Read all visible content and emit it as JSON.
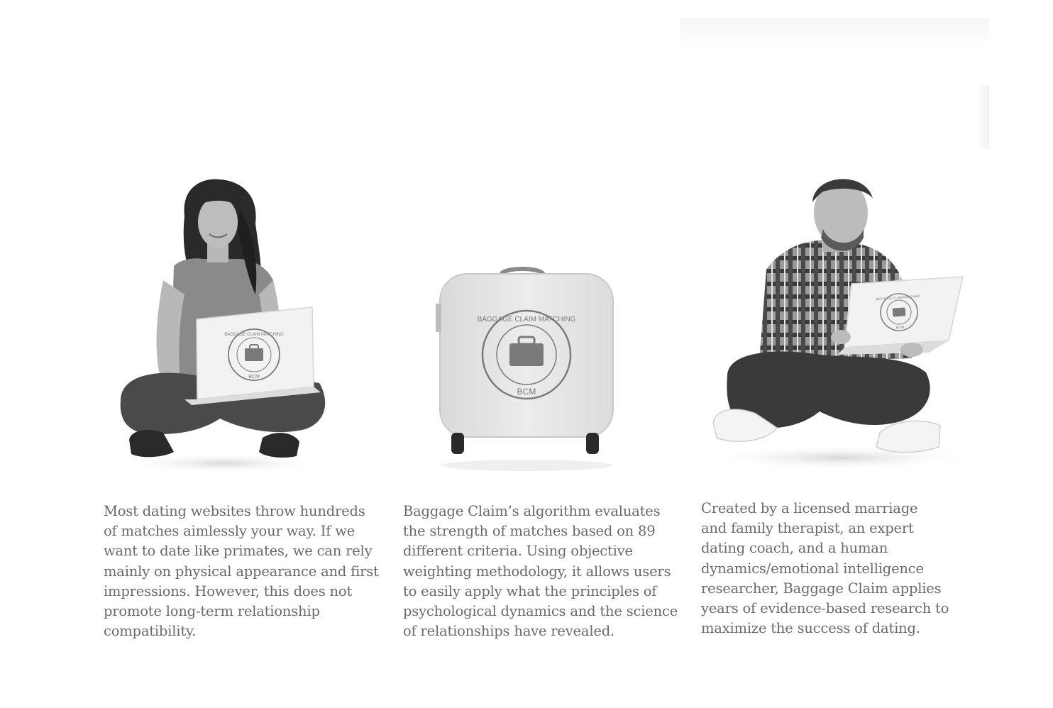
{
  "columns": [
    {
      "id": "woman",
      "illustration": "woman-with-laptop",
      "logo": {
        "ring_text": "BAGGAGE CLAIM MATCHING",
        "initials": "BCM"
      },
      "caption_lines": [
        "Most dating websites throw hundreds",
        "of matches aimlessly your way. If we",
        "want to date like primates, we can rely",
        "mainly on physical appearance and first",
        "impressions. However, this does not",
        "promote long-term relationship",
        "compatibility."
      ]
    },
    {
      "id": "suitcase",
      "illustration": "suitcase-with-logo",
      "logo": {
        "ring_text": "BAGGAGE CLAIM MATCHING",
        "initials": "BCM"
      },
      "caption_lines": [
        "Baggage Claim’s algorithm evaluates",
        "the strength of matches based on 89",
        "different criteria. Using objective",
        "weighting methodology, it allows users",
        "to easily apply what the principles of",
        "psychological dynamics and the science",
        "of relationships have revealed."
      ]
    },
    {
      "id": "man",
      "illustration": "man-with-laptop",
      "logo": {
        "ring_text": "BAGGAGE CLAIM MATCHING",
        "initials": "BCM"
      },
      "caption_lines": [
        "Created by a licensed marriage",
        "and family therapist, an expert",
        "dating coach, and a human",
        "dynamics/emotional intelligence",
        "researcher, Baggage Claim applies",
        "years of evidence-based research to",
        "maximize the success of dating."
      ]
    }
  ],
  "colors": {
    "text": "#6a6a6a",
    "background": "#ffffff",
    "laptop": "#f2f2f2",
    "suitcase": "#e6e6e6",
    "logo": "#7a7a7a",
    "jeans": "#4a4a4a",
    "skin": "#b8b8b8",
    "hair": "#2a2a2a"
  }
}
